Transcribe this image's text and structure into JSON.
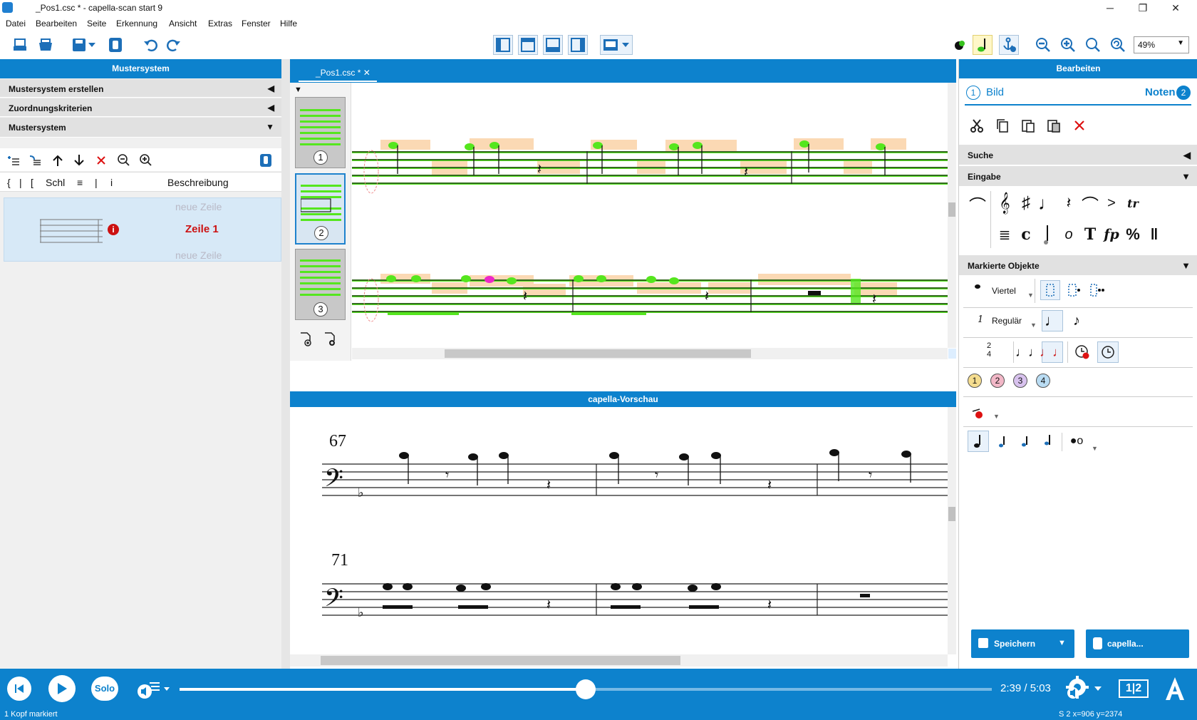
{
  "window": {
    "title": "_Pos1.csc * - capella-scan start 9",
    "minimize": "─",
    "restore": "❐",
    "close": "✕"
  },
  "menu": [
    "Datei",
    "Bearbeiten",
    "Seite",
    "Erkennung",
    "Ansicht",
    "Extras",
    "Fenster",
    "Hilfe"
  ],
  "toolbar": {
    "zoom": "49%"
  },
  "left": {
    "header": "Mustersystem",
    "sections": [
      "Mustersystem erstellen",
      "Zuordnungskriterien",
      "Mustersystem"
    ],
    "columns": {
      "brace": "{",
      "bar": "|",
      "bracket": "[",
      "clef": "Schl",
      "lines": "≡",
      "pipe": "|",
      "info": "i",
      "desc": "Beschreibung"
    },
    "row_placeholder_top": "neue Zeile",
    "row_label": "Zeile 1",
    "row_placeholder_bottom": "neue Zeile"
  },
  "center": {
    "tab": "_Pos1.csc *",
    "thumbnails": [
      "1",
      "2",
      "3"
    ],
    "preview_header": "capella-Vorschau",
    "measure_numbers": [
      "67",
      "71"
    ]
  },
  "right": {
    "header": "Bearbeiten",
    "step1_num": "1",
    "step1": "Bild",
    "step2": "Noten",
    "step2_num": "2",
    "sections": [
      "Suche",
      "Eingabe",
      "Markierte Objekte"
    ],
    "duration": "Viertel",
    "style_num": "1",
    "style": "Regulär",
    "timesig_top": "2",
    "timesig_bottom": "4",
    "voices": [
      "1",
      "2",
      "3",
      "4"
    ],
    "save_button": "Speichern",
    "capella_button": "capella..."
  },
  "player": {
    "solo": "Solo",
    "time": "2:39 / 5:03",
    "progress": 0.5,
    "numbers": "1|2"
  },
  "status": {
    "left": "1 Kopf markiert",
    "right": "S 2  x=906 y=2374"
  },
  "colors": {
    "accent": "#0d82cd",
    "recognized": "#55e61e",
    "highlight": "#fbd9b4",
    "error": "#cc1111"
  }
}
